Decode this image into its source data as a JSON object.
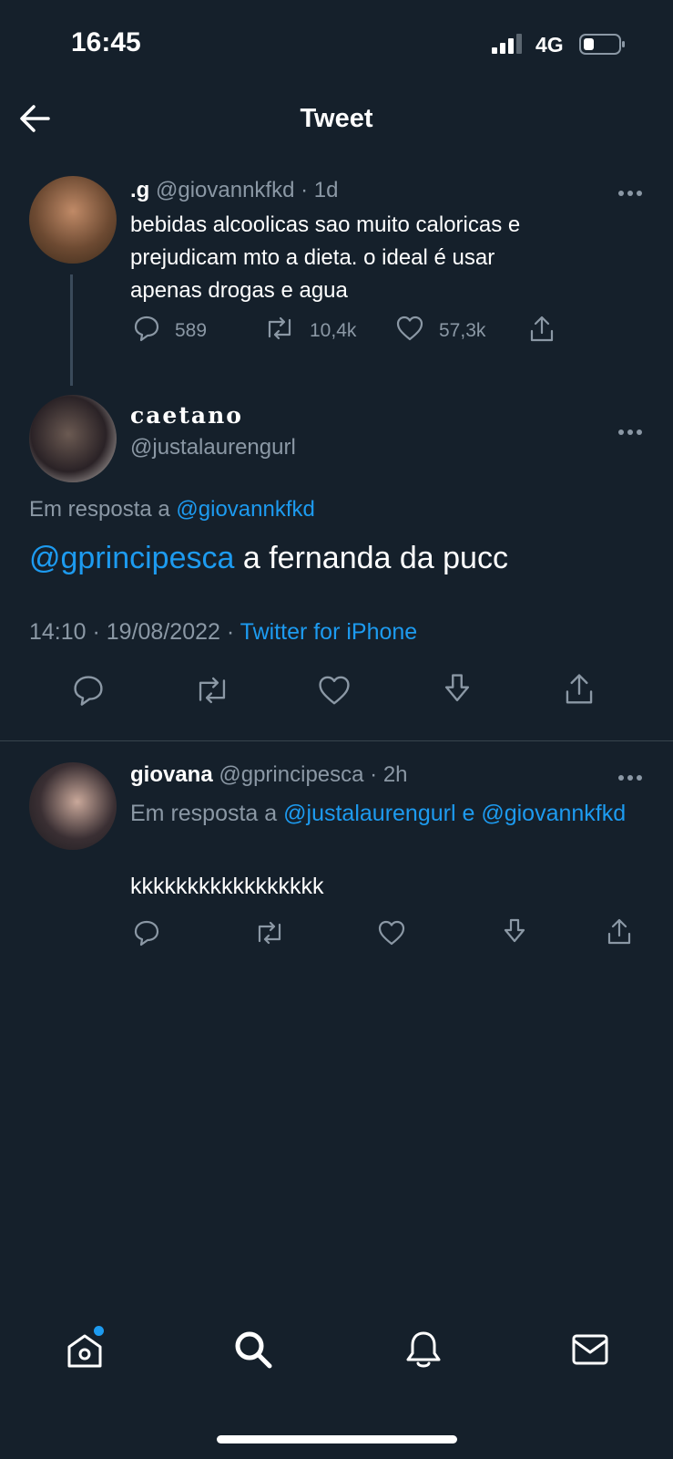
{
  "status_bar": {
    "time": "16:45",
    "network": "4G"
  },
  "header": {
    "title": "Tweet"
  },
  "thread": [
    {
      "display_name": ".g",
      "handle": "@giovannkfkd",
      "time": "· 1d",
      "text": "bebidas alcoolicas sao muito caloricas e\nprejudicam mto a dieta. o ideal é usar\napenas drogas e agua",
      "counts": {
        "replies": "589",
        "retweets": "10,4k",
        "likes": "57,3k"
      }
    }
  ],
  "focus_tweet": {
    "display_name": "caetano",
    "handle": "@justalaurengurl",
    "reply_prefix": "Em resposta a",
    "reply_to": "@giovannkfkd",
    "mention": "@gprincipesca",
    "text": " a fernanda da pucc",
    "timestamp": "14:10 · 19/08/2022 · ",
    "source": "Twitter for iPhone"
  },
  "replies": [
    {
      "display_name": "giovana",
      "handle": "@gprincipesca",
      "time": "· 2h",
      "reply_prefix": "Em resposta a",
      "reply_to_1": "@justalaurengurl",
      "reply_and": "e",
      "reply_to_2": "@giovannkfkd",
      "text": "kkkkkkkkkkkkkkkkk"
    }
  ],
  "bottom_nav": {
    "items": [
      {
        "icon": "home-icon",
        "has_badge": true
      },
      {
        "icon": "search-icon"
      },
      {
        "icon": "bell-icon"
      },
      {
        "icon": "mail-icon"
      }
    ]
  },
  "colors": {
    "background": "#15202b",
    "link": "#1d9bf0",
    "muted": "#8b98a5",
    "badge": "#1d9bf0"
  }
}
